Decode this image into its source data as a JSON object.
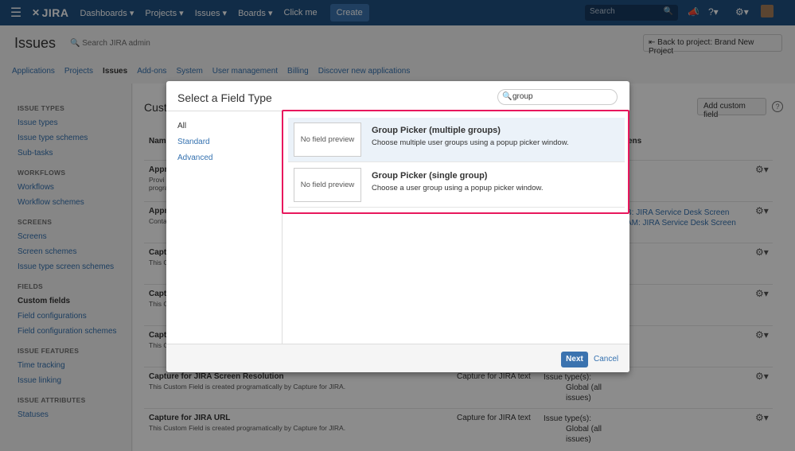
{
  "topnav": {
    "logo": "JIRA",
    "items": [
      "Dashboards ▾",
      "Projects ▾",
      "Issues ▾",
      "Boards ▾",
      "Click me"
    ],
    "create": "Create",
    "search_placeholder": "Search"
  },
  "header": {
    "title": "Issues",
    "search_admin": "Search JIRA admin",
    "back": "Back to project: Brand New Project"
  },
  "tabs": [
    {
      "label": "Applications",
      "active": false
    },
    {
      "label": "Projects",
      "active": false
    },
    {
      "label": "Issues",
      "active": true
    },
    {
      "label": "Add-ons",
      "active": false
    },
    {
      "label": "System",
      "active": false
    },
    {
      "label": "User management",
      "active": false
    },
    {
      "label": "Billing",
      "active": false
    },
    {
      "label": "Discover new applications",
      "active": false
    }
  ],
  "sidebar": [
    {
      "group": "ISSUE TYPES",
      "items": [
        "Issue types",
        "Issue type schemes",
        "Sub-tasks"
      ]
    },
    {
      "group": "WORKFLOWS",
      "items": [
        "Workflows",
        "Workflow schemes"
      ]
    },
    {
      "group": "SCREENS",
      "items": [
        "Screens",
        "Screen schemes",
        "Issue type screen schemes"
      ]
    },
    {
      "group": "FIELDS",
      "items": [
        "Custom fields",
        "Field configurations",
        "Field configuration schemes"
      ]
    },
    {
      "group": "ISSUE FEATURES",
      "items": [
        "Time tracking",
        "Issue linking"
      ]
    },
    {
      "group": "ISSUE ATTRIBUTES",
      "items": [
        "Statuses"
      ]
    }
  ],
  "sidebar_current": "Custom fields",
  "main": {
    "title_partial": "Cust",
    "add_custom_field": "Add custom field",
    "col_name": "Nam",
    "col_screens": "ens",
    "rows": [
      {
        "name": "Appr",
        "desc": [
          "Provi",
          "progra"
        ],
        "type": "",
        "context": [],
        "screens": []
      },
      {
        "name": "Appr",
        "desc": [
          "Conta"
        ],
        "type": "",
        "context": [],
        "screens": [
          "B: JIRA Service Desk Screen",
          "AM: JIRA Service Desk Screen"
        ]
      },
      {
        "name": "Captu",
        "desc": [
          "This C"
        ],
        "type": "",
        "context": [],
        "screens": []
      },
      {
        "name": "Captu",
        "desc": [
          "This C"
        ],
        "type": "",
        "context": [],
        "screens": []
      },
      {
        "name": "Captu",
        "desc": [
          "This C"
        ],
        "type": "",
        "context": [],
        "screens": []
      },
      {
        "name": "Capture for JIRA Screen Resolution",
        "desc": [
          "This Custom Field is created programatically by Capture for JIRA."
        ],
        "type": "Capture for JIRA text",
        "context": [
          "Issue type(s):",
          "Global (all",
          "issues)"
        ],
        "screens": []
      },
      {
        "name": "Capture for JIRA URL",
        "desc": [
          "This Custom Field is created programatically by Capture for JIRA."
        ],
        "type": "Capture for JIRA text",
        "context": [
          "Issue type(s):",
          "Global (all",
          "issues)"
        ],
        "screens": []
      }
    ]
  },
  "dialog": {
    "title": "Select a Field Type",
    "search_value": "group",
    "nav": [
      {
        "label": "All",
        "active": true
      },
      {
        "label": "Standard",
        "active": false
      },
      {
        "label": "Advanced",
        "active": false
      }
    ],
    "fields": [
      {
        "preview": "No field preview",
        "name": "Group Picker (multiple groups)",
        "desc": "Choose multiple user groups using a popup picker window.",
        "selected": true
      },
      {
        "preview": "No field preview",
        "name": "Group Picker (single group)",
        "desc": "Choose a user group using a popup picker window.",
        "selected": false
      }
    ],
    "next": "Next",
    "cancel": "Cancel"
  }
}
